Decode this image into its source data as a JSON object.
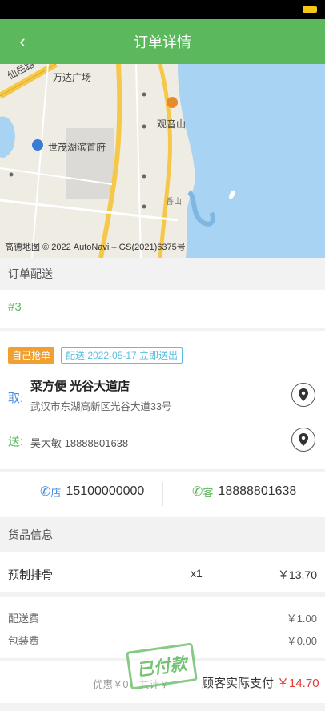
{
  "header": {
    "title": "订单详情",
    "back_icon": "‹"
  },
  "map": {
    "labels": [
      "仙岳路",
      "万达广场",
      "观音山",
      "世茂湖滨首府",
      "香山"
    ],
    "copyright": "高德地图 © 2022 AutoNavi – GS(2021)6375号"
  },
  "delivery_section": {
    "title": "订单配送"
  },
  "order": {
    "number": "#3"
  },
  "badges": {
    "self_grab": "自己抢单",
    "delivery_time": "配送 2022-05-17 立即送出"
  },
  "pickup": {
    "tag": "取:",
    "name": "菜方便 光谷大道店",
    "address": "武汉市东湖高新区光谷大道33号"
  },
  "dropoff": {
    "tag": "送:",
    "text": "吴大敏 18888801638"
  },
  "contacts": {
    "store_tag": "店",
    "store_phone": "15100000000",
    "customer_tag": "客",
    "customer_phone": "18888801638"
  },
  "goods_section": {
    "title": "货品信息"
  },
  "goods": [
    {
      "name": "预制排骨",
      "qty": "x1",
      "price": "￥13.70"
    }
  ],
  "fees": [
    {
      "label": "配送费",
      "value": "￥1.00"
    },
    {
      "label": "包装费",
      "value": "￥0.00"
    }
  ],
  "summary": {
    "discount": "优惠￥0",
    "total_partial": "共计￥",
    "stamp": "已付款",
    "pay_label": "顾客实际支付",
    "pay_value": "￥14.70"
  },
  "colors": {
    "brand": "#5cb85c",
    "accent_red": "#e03c3c",
    "link_blue": "#4a90e2",
    "badge_orange": "#f0a030"
  }
}
